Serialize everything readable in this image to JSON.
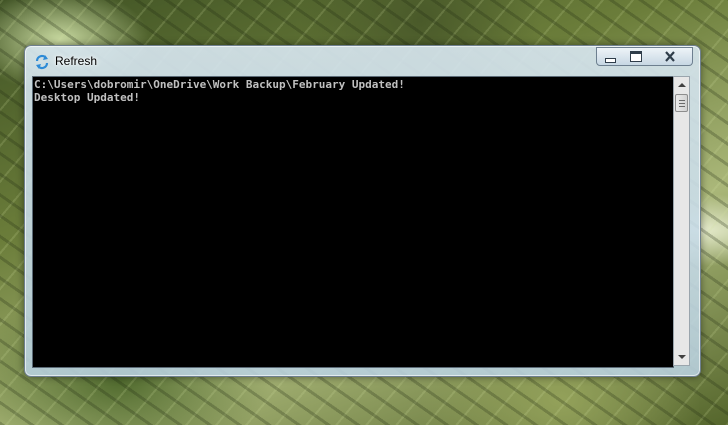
{
  "window": {
    "title": "Refresh",
    "icon": "refresh-icon"
  },
  "console": {
    "line1": "C:\\Users\\dobromir\\OneDrive\\Work Backup\\February Updated!",
    "line2": "Desktop Updated!"
  },
  "caption_buttons": {
    "minimize_icon": "minimize-icon",
    "maximize_icon": "restore-icon",
    "close_icon": "close-icon"
  },
  "colors": {
    "console_bg": "#000000",
    "console_text": "#c0c0c0",
    "icon_accent": "#2e8bd6"
  }
}
